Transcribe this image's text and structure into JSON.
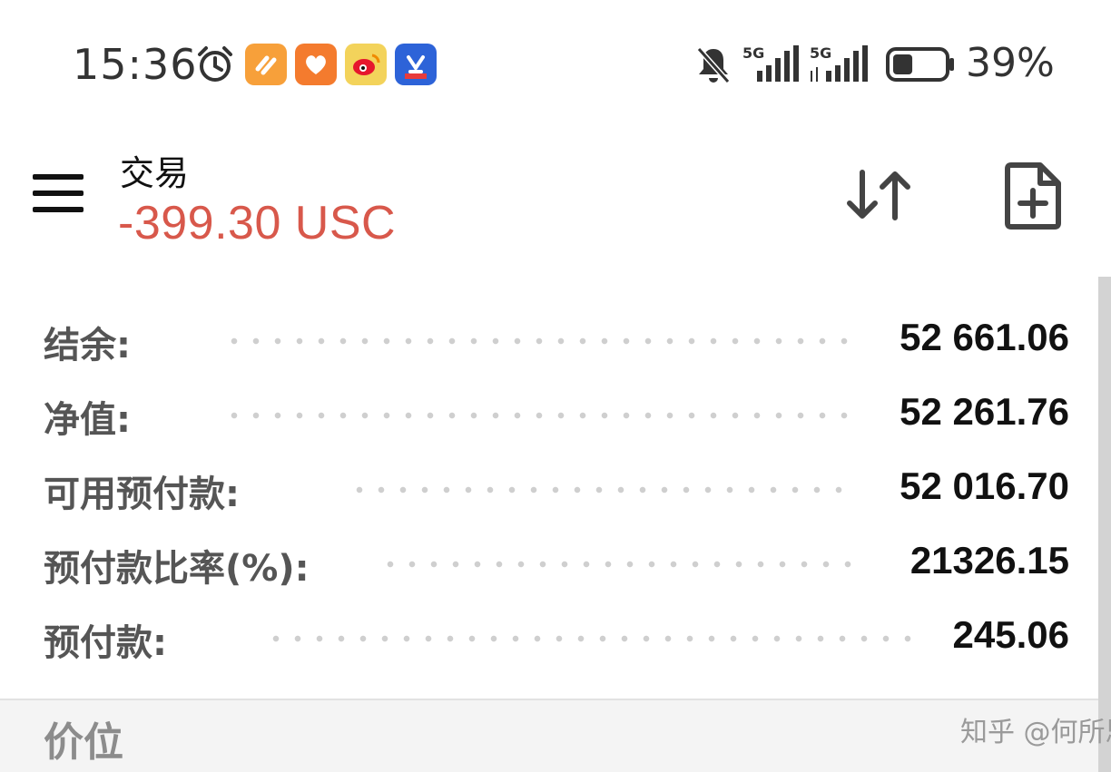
{
  "status_bar": {
    "time": "15:36",
    "icons": [
      "alarm-icon",
      "app-icon-orange",
      "app-icon-heart",
      "weibo-icon",
      "app-icon-blue",
      "mute-icon"
    ],
    "signal_1_label": "5G",
    "signal_2_label": "5G",
    "battery_percent_text": "39%",
    "battery_level": 0.39
  },
  "header": {
    "title": "交易",
    "balance_change": "-399.30 USC",
    "balance_color": "#d8584b",
    "menu_icon": "hamburger-menu-icon",
    "sort_icon": "sort-arrows-icon",
    "new_order_icon": "new-document-icon"
  },
  "summary": {
    "rows": [
      {
        "label": "结余:",
        "value": "52 661.06"
      },
      {
        "label": "净值:",
        "value": "52 261.76"
      },
      {
        "label": "可用预付款:",
        "value": "52 016.70"
      },
      {
        "label": "预付款比率(%):",
        "value": "21326.15"
      },
      {
        "label": "预付款:",
        "value": "245.06"
      }
    ]
  },
  "section": {
    "title": "价位"
  },
  "watermark": "知乎 @何所思"
}
